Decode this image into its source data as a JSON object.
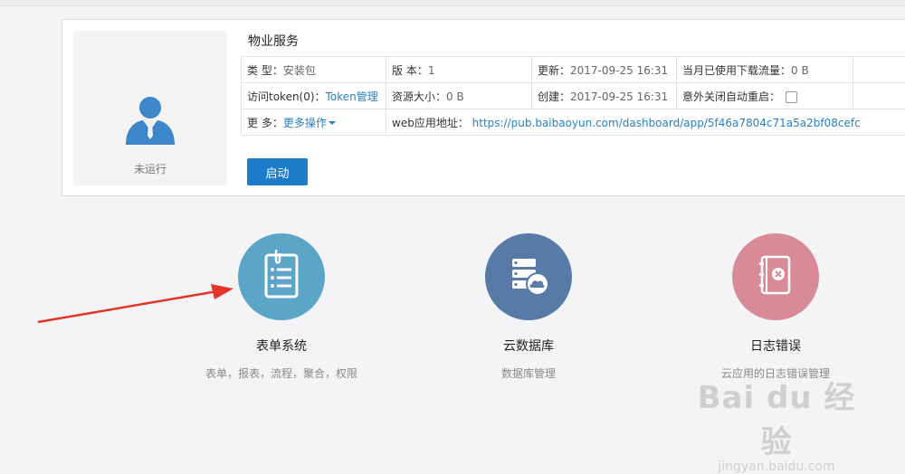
{
  "app": {
    "name": "物业服务",
    "status": "未运行",
    "start_label": "启动",
    "fields": {
      "type_label": "类  型：",
      "type_value": "安装包",
      "version_label": "版  本：",
      "version_value": "1",
      "updated_label": "更新：",
      "updated_value": "2017-09-25 16:31",
      "traffic_label": "当月已使用下载流量：",
      "traffic_value": "0 B",
      "token_label": "访问token(0)：",
      "token_link": "Token管理",
      "size_label": "资源大小：",
      "size_value": "0 B",
      "created_label": "创建：",
      "created_value": "2017-09-25 16:31",
      "autorestart_label": "意外关闭自动重启：",
      "more_label": "更  多：",
      "more_link": "更多操作",
      "url_label": "web应用地址：",
      "url_value": "https://pub.baibaoyun.com/dashboard/app/5f46a7804c71a5a2bf08cefc"
    }
  },
  "features": [
    {
      "title": "表单系统",
      "desc": "表单，报表，流程，聚合，权限",
      "icon": "form-icon",
      "color": "#5ba5c9"
    },
    {
      "title": "云数据库",
      "desc": "数据库管理",
      "icon": "cloud-database-icon",
      "color": "#577aa6"
    },
    {
      "title": "日志错误",
      "desc": "云应用的日志错误管理",
      "icon": "error-log-icon",
      "color": "#d98a97"
    }
  ],
  "watermark": {
    "main": "Bai du 经验",
    "sub": "jingyan.baidu.com"
  },
  "colors": {
    "primary": "#1b7ccc",
    "link": "#2a7fbf",
    "arrow": "#e5342c"
  }
}
